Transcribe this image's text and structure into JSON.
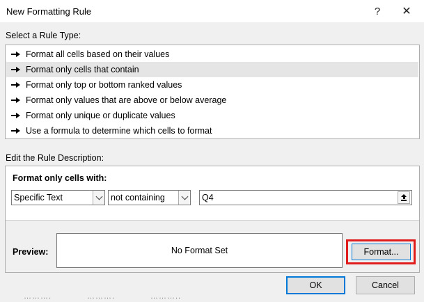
{
  "window": {
    "title": "New Formatting Rule",
    "help_glyph": "?",
    "close_glyph": "✕"
  },
  "rule_type": {
    "label": "Select a Rule Type:",
    "items": [
      "Format all cells based on their values",
      "Format only cells that contain",
      "Format only top or bottom ranked values",
      "Format only values that are above or below average",
      "Format only unique or duplicate values",
      "Use a formula to determine which cells to format"
    ],
    "selected_index": 1
  },
  "description": {
    "label": "Edit the Rule Description:",
    "cells_with_label": "Format only cells with:",
    "type_value": "Specific Text",
    "operator_value": "not containing",
    "text_value": "Q4",
    "preview_label": "Preview:",
    "preview_text": "No Format Set",
    "format_button": "Format..."
  },
  "buttons": {
    "ok": "OK",
    "cancel": "Cancel"
  },
  "background_strip": [
    "……….",
    "……….",
    "……….."
  ],
  "colors": {
    "accent": "#0078d7",
    "highlight": "#e01b1b",
    "selected_row": "#e5e5e5"
  }
}
